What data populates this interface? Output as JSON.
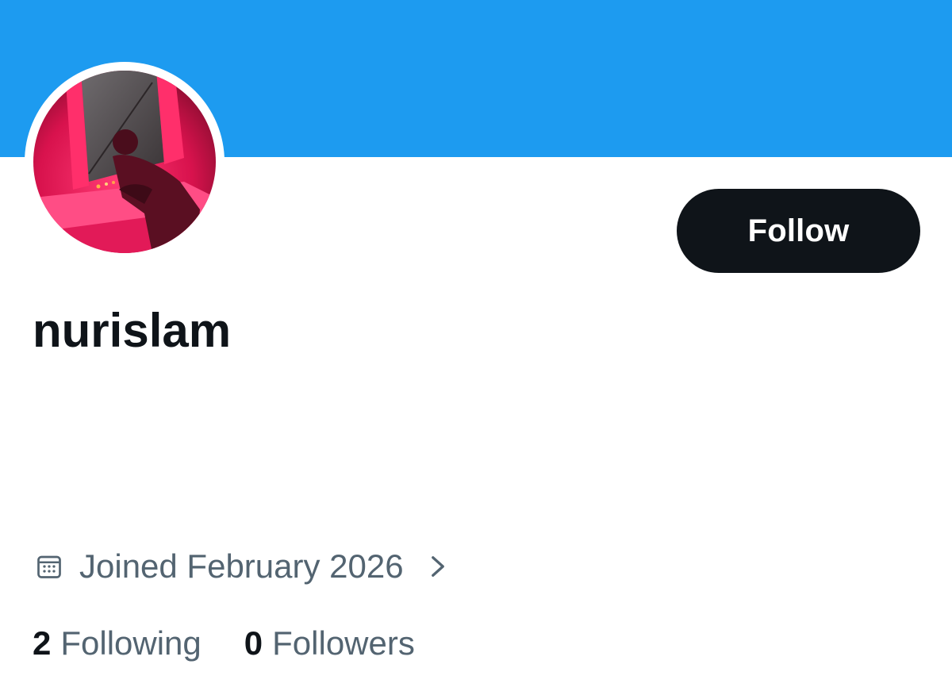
{
  "colors": {
    "banner": "#1d9bf0",
    "follow_button_bg": "#0f1419",
    "follow_button_text": "#ffffff",
    "primary_text": "#0f1419",
    "secondary_text": "#536471"
  },
  "profile": {
    "display_name": "nurislam",
    "avatar_icon": "profile-photo-red-lit-person-at-window",
    "follow_label": "Follow",
    "joined_icon": "calendar-icon",
    "joined_text": "Joined February 2026",
    "joined_chevron_icon": "chevron-right-icon"
  },
  "stats": {
    "following_count": "2",
    "following_label": "Following",
    "followers_count": "0",
    "followers_label": "Followers"
  }
}
